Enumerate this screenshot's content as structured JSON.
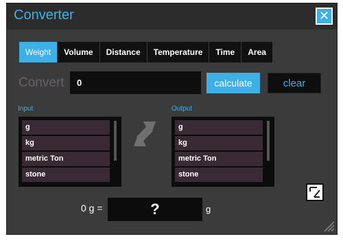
{
  "app": {
    "title": "Converter"
  },
  "tabs": [
    "Weight",
    "Volume",
    "Distance",
    "Temperature",
    "Time",
    "Area"
  ],
  "convert": {
    "label": "Convert",
    "value": "0",
    "calculate_label": "calculate",
    "clear_label": "clear"
  },
  "input": {
    "label": "Input",
    "items": [
      "g",
      "kg",
      "metric Ton",
      "stone"
    ]
  },
  "output": {
    "label": "Output",
    "items": [
      "g",
      "kg",
      "metric Ton",
      "stone"
    ]
  },
  "result": {
    "prefix": "0 g =",
    "value": "?",
    "unit": "g"
  },
  "icons": {
    "close": "close-icon",
    "swap": "swap-arrows-icon",
    "fullscreen": "expand-icon",
    "resize": "resize-grip-icon"
  },
  "colors": {
    "accent": "#3db0e8",
    "window": "#3b3b3b",
    "titlebar": "#2c2c2c"
  }
}
